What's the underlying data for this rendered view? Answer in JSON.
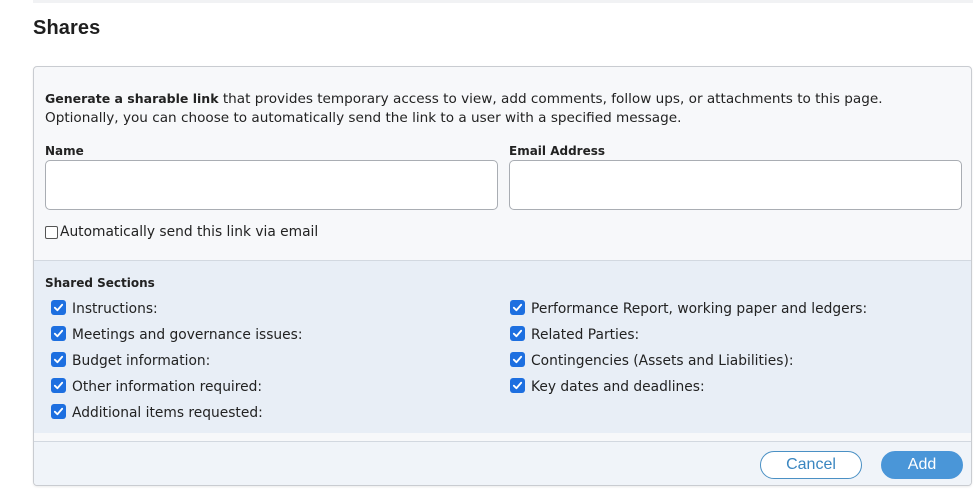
{
  "page": {
    "title": "Shares"
  },
  "description": {
    "strong": "Generate a sharable link",
    "rest1": " that provides temporary access to view, add comments, follow ups, or attachments to this page.",
    "line2": "Optionally, you can choose to automatically send the link to a user with a specified message."
  },
  "form": {
    "name_label": "Name",
    "name_value": "",
    "email_label": "Email Address",
    "email_value": "",
    "auto_send_label": "Automatically send this link via email",
    "auto_send_checked": false
  },
  "shared_sections": {
    "title": "Shared Sections",
    "left": [
      {
        "label": "Instructions:",
        "checked": true
      },
      {
        "label": "Meetings and governance issues:",
        "checked": true
      },
      {
        "label": "Budget information:",
        "checked": true
      },
      {
        "label": "Other information required:",
        "checked": true
      },
      {
        "label": "Additional items requested:",
        "checked": true
      }
    ],
    "right": [
      {
        "label": "Performance Report, working paper and ledgers:",
        "checked": true
      },
      {
        "label": "Related Parties:",
        "checked": true
      },
      {
        "label": "Contingencies (Assets and Liabilities):",
        "checked": true
      },
      {
        "label": "Key dates and deadlines:",
        "checked": true
      }
    ]
  },
  "footer": {
    "cancel_label": "Cancel",
    "add_label": "Add"
  },
  "colors": {
    "accent": "#1d6fe0",
    "button_primary": "#4a96d8",
    "sections_bg": "#e8eef6"
  }
}
